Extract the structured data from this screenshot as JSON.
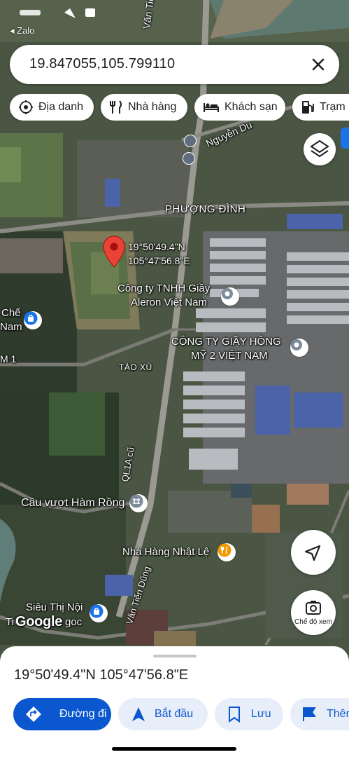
{
  "status_bar": {
    "back_app": "Zalo"
  },
  "search": {
    "query": "19.847055,105.799110"
  },
  "chips": [
    {
      "label": "Địa danh",
      "icon": "landmark-icon"
    },
    {
      "label": "Nhà hàng",
      "icon": "restaurant-icon"
    },
    {
      "label": "Khách sạn",
      "icon": "hotel-icon"
    },
    {
      "label": "Trạm",
      "icon": "gas-station-icon"
    }
  ],
  "map": {
    "labels": {
      "road_van_tien_dung_top": "Văn Tiến Dũng",
      "road_nguyen_du": "Nguyễn Du",
      "area_phuong_dinh": "PHƯỢNG ĐÌNH",
      "pin_lat": "19°50'49.4\"N",
      "pin_lng": "105°47'56.8\"E",
      "company_aleron_line1": "Công ty TNHH Giầy",
      "company_aleron_line2": "Aleron Việt Nam",
      "company_hong_my_line1": "CÔNG TY GIẦY HỒNG",
      "company_hong_my_line2": "MỸ 2 VIỆT NAM",
      "poi_che_line1": "Chế",
      "poi_che_line2": "Nam",
      "poi_m1": "M 1",
      "area_tao_xu": "TÀO XÙ",
      "road_ql1a_cu": "QL1A cũ",
      "bridge_ham_rong": "Cầu vượt Hàm Rồng",
      "restaurant_nhat_le": "Nhà Hàng Nhật Lệ",
      "road_van_tien_dung_bottom": "Văn Tiến Dũng",
      "supermarket_line1": "Siêu Thị Nội",
      "supermarket_line2_left": "Ti",
      "supermarket_line2_right": "goc",
      "watermark": "Google"
    },
    "street_view_label": "Chế độ xem"
  },
  "bottom_sheet": {
    "coordinates": "19°50'49.4\"N 105°47'56.8\"E",
    "actions": [
      {
        "label": "Đường đi",
        "icon": "directions-icon"
      },
      {
        "label": "Bắt đầu",
        "icon": "navigation-arrow-icon"
      },
      {
        "label": "Lưu",
        "icon": "bookmark-icon"
      },
      {
        "label": "Thêm",
        "icon": "flag-icon"
      }
    ]
  },
  "colors": {
    "accent": "#0b57d0",
    "pin": "#ea4335",
    "chip_bg": "#ffffff",
    "secondary_bg": "#e8eef9"
  }
}
